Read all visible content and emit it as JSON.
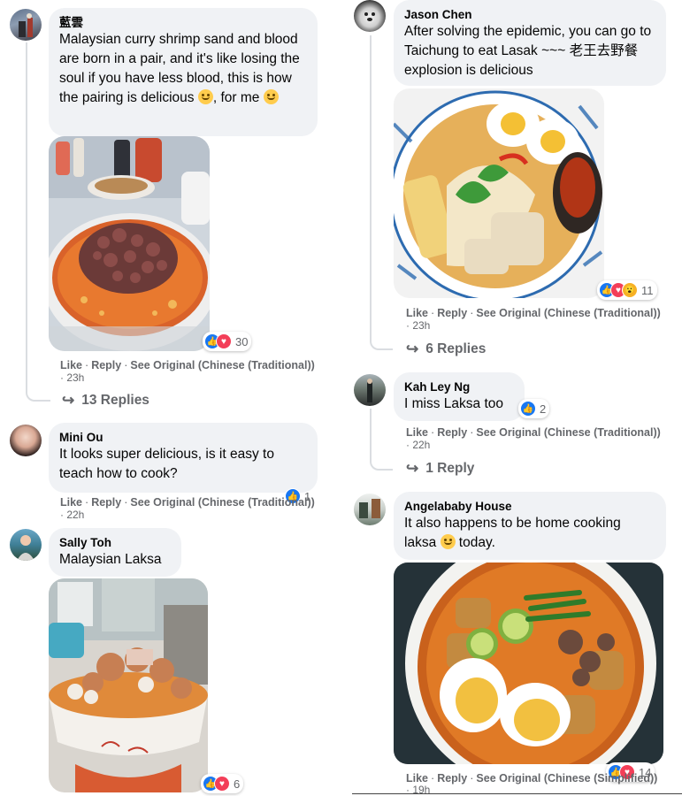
{
  "actions": {
    "like": "Like",
    "reply": "Reply",
    "see_original_trad": "See Original (Chinese (Traditional))",
    "see_original_simp": "See Original (Chinese (Simplified))",
    "separator": "·"
  },
  "left": {
    "c1": {
      "author": "藍雲",
      "text": "Malaysian curry shrimp sand and blood are born in a pair, and it's like losing the soul if you have less blood, this is how the pairing is delicious",
      "text_tail": ", for me",
      "reactions": "30",
      "time": "· 23h",
      "replies": "13 Replies",
      "reaction_icons": [
        "like",
        "love"
      ]
    },
    "c2": {
      "author": "Mini Ou",
      "text": "It looks super delicious, is it easy to teach how to cook?",
      "reactions": "1",
      "time": "· 22h",
      "reaction_icons": [
        "like"
      ]
    },
    "c3": {
      "author": "Sally Toh",
      "text": "Malaysian Laksa",
      "reactions": "6",
      "reaction_icons": [
        "like",
        "love"
      ]
    }
  },
  "right": {
    "c1": {
      "author": "Jason Chen",
      "text": "After solving the epidemic, you can go to Taichung to eat Lasak ~~~ 老王去野餐 explosion is delicious",
      "reactions": "11",
      "time": "· 23h",
      "replies": "6 Replies",
      "reaction_icons": [
        "like",
        "love",
        "wow"
      ]
    },
    "c2": {
      "author": "Kah Ley Ng",
      "text": "I miss Laksa too",
      "reactions": "2",
      "time": "· 22h",
      "replies": "1 Reply",
      "reaction_icons": [
        "like"
      ]
    },
    "c3": {
      "author": "Angelababy House",
      "text": "It also happens to be home cooking laksa",
      "text_tail": " today.",
      "reactions": "14",
      "time": "· 19h",
      "reaction_icons": [
        "like",
        "love"
      ]
    }
  },
  "colors": {
    "bubble": "#f0f2f5",
    "like": "#1877f2",
    "love": "#f33e58",
    "wow": "#f7b125",
    "meta": "#65676b"
  }
}
